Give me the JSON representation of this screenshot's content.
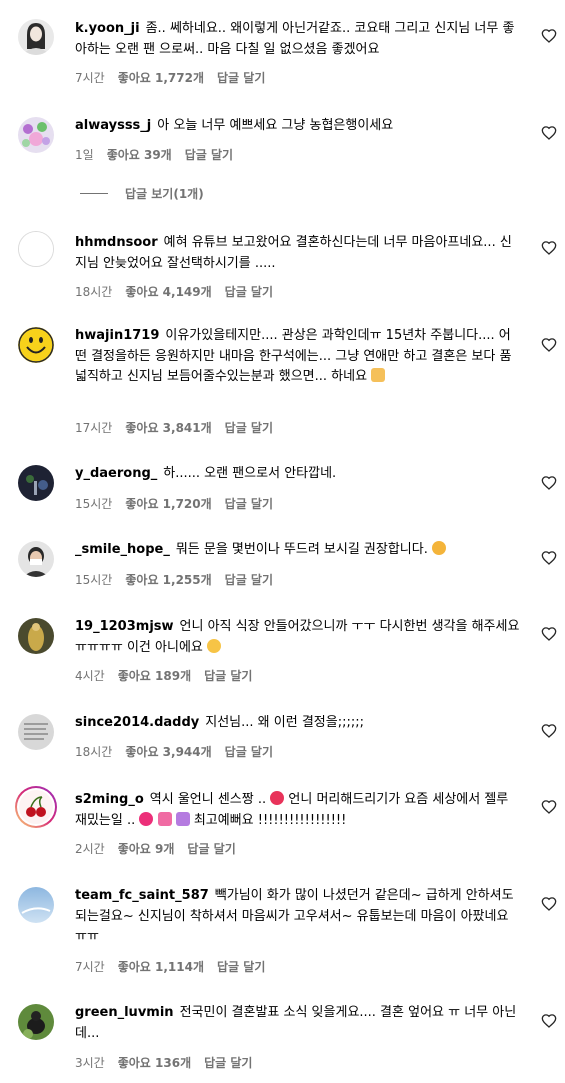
{
  "comments": [
    {
      "user": "k.yoon_ji",
      "text": "좀.. 쎄하네요.. 왜이렇게 아닌거같죠.. 코요태 그리고 신지님 너무 좋아하는 오랜 팬 으로써.. 마음 다칠 일 없으셨음 좋겠어요",
      "time": "7시간",
      "likes": "좋아요 1,772개",
      "reply": "답글 달기"
    },
    {
      "user": "alwaysss_j",
      "text": "아 오늘 너무 예쁘세요 그냥 농협은행이세요",
      "time": "1일",
      "likes": "좋아요 39개",
      "reply": "답글 달기"
    },
    {
      "user": "hhmdnsoor",
      "text": "예혀 유튜브 보고왔어요 결혼하신다는데 너무 마음아프네요... 신지님 안늦었어요 잘선택하시기를 .....",
      "time": "18시간",
      "likes": "좋아요 4,149개",
      "reply": "답글 달기"
    },
    {
      "user": "hwajin1719",
      "text": "이유가있을테지만.... 관상은 과학인데ㅠ 15년차 주붑니다.... 어떤 결정을하든 응원하지만 내마음 한구석에는... 그냥 연애만 하고 결혼은 보다 품 넓직하고 신지님 보듬어줄수있는분과 했으면... 하네요",
      "time": "17시간",
      "likes": "좋아요 3,841개",
      "reply": "답글 달기"
    },
    {
      "user": "y_daerong_",
      "text": "하...... 오랜 팬으로서 안타깝네.",
      "time": "15시간",
      "likes": "좋아요 1,720개",
      "reply": "답글 달기"
    },
    {
      "user": "_smile_hope_",
      "text": "뭐든 문을 몇번이나 뚜드려 보시길 권장합니다.",
      "time": "15시간",
      "likes": "좋아요 1,255개",
      "reply": "답글 달기"
    },
    {
      "user": "19_1203mjsw",
      "text": "언니 아직 식장 안들어갔으니까 ㅜㅜ 다시한번 생각을 해주세요 ㅠㅠㅠㅠ 이건 아니에요",
      "time": "4시간",
      "likes": "좋아요 189개",
      "reply": "답글 달기"
    },
    {
      "user": "since2014.daddy",
      "text": "지선님... 왜 이런 결정을;;;;;;",
      "time": "18시간",
      "likes": "좋아요 3,944개",
      "reply": "답글 달기"
    },
    {
      "user": "s2ming_o",
      "text1": "역시 울언니 센스짱 ..",
      "text2": "언니 머리해드리기가 요즘 세상에서 젤루 재밌는일 ..",
      "text3": "최고예뻐요 !!!!!!!!!!!!!!!!!",
      "time": "2시간",
      "likes": "좋아요 9개",
      "reply": "답글 달기"
    },
    {
      "user": "team_fc_saint_587",
      "text": "빽가님이 화가 많이 나셨던거 같은데~ 급하게 안하셔도 되는걸요~ 신지님이 착하셔서 마음씨가 고우셔서~ 유툽보는데 마음이 아팠네요ㅠㅠ",
      "time": "7시간",
      "likes": "좋아요 1,114개",
      "reply": "답글 달기"
    },
    {
      "user": "green_luvmin",
      "text": "전국민이 결혼발표 소식 잊을게요.... 결혼 엎어요 ㅠ 너무 아닌데...",
      "time": "3시간",
      "likes": "좋아요 136개",
      "reply": "답글 달기"
    }
  ],
  "view_replies": "답글 보기(1개)",
  "icons": {
    "like": "heart-outline-icon",
    "emoji_pray": "folded-hands-emoji",
    "emoji_grin": "grinning-face-emoji",
    "emoji_flushed": "flushed-face-emoji",
    "emoji_heart": "heart-emoji",
    "emoji_gift_heart": "gift-heart-emoji"
  },
  "colors": {
    "meta": "#737373",
    "text": "#000000"
  }
}
